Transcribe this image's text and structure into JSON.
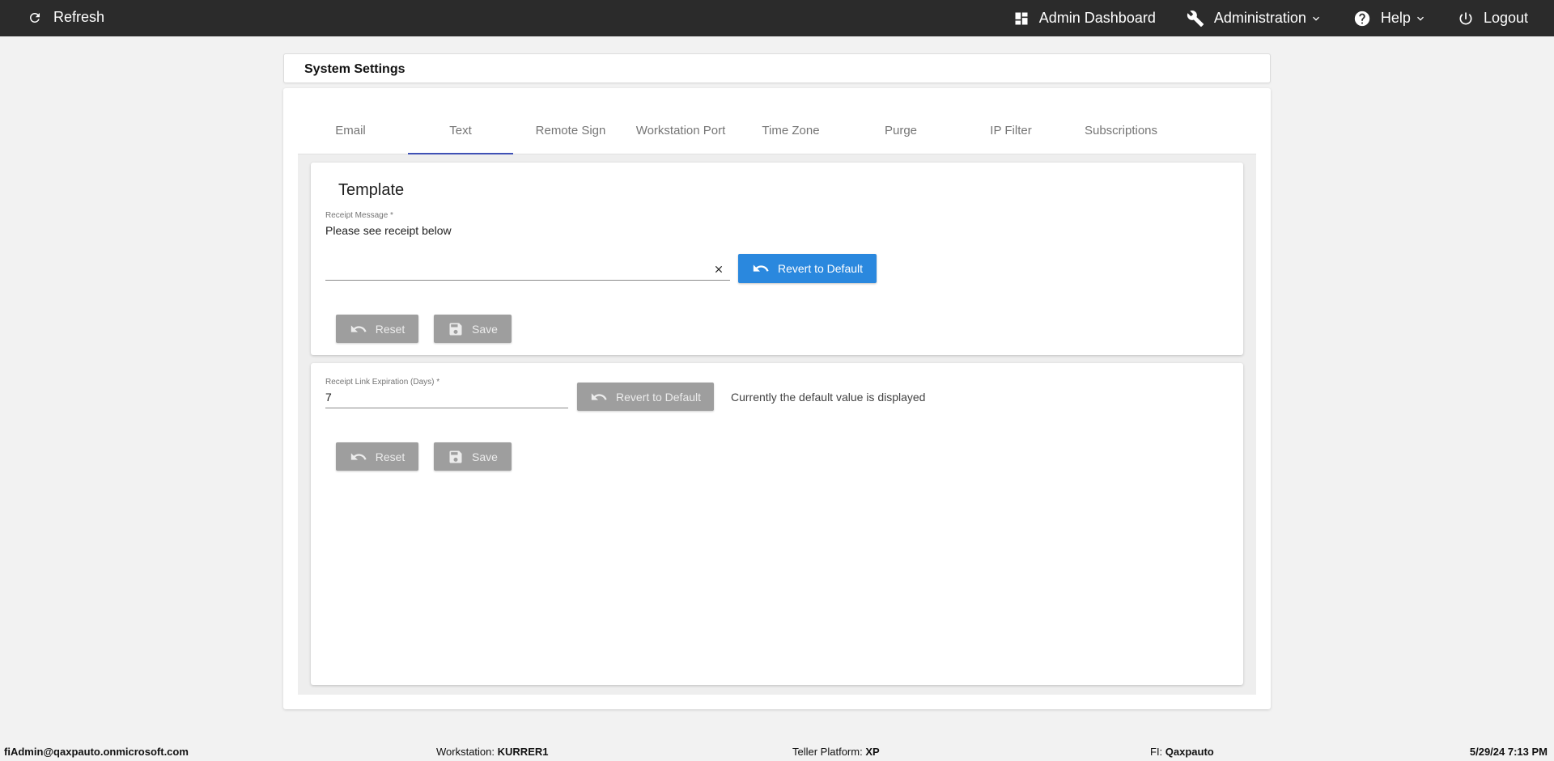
{
  "topbar": {
    "refresh_label": "Refresh",
    "admin_dashboard_label": "Admin Dashboard",
    "administration_label": "Administration",
    "help_label": "Help",
    "logout_label": "Logout"
  },
  "page": {
    "title": "System Settings"
  },
  "tabs": [
    {
      "label": "Email"
    },
    {
      "label": "Text"
    },
    {
      "label": "Remote Sign"
    },
    {
      "label": "Workstation Port"
    },
    {
      "label": "Time Zone"
    },
    {
      "label": "Purge"
    },
    {
      "label": "IP Filter"
    },
    {
      "label": "Subscriptions"
    }
  ],
  "active_tab": "Text",
  "template_card": {
    "title": "Template",
    "receipt_message_label": "Receipt Message *",
    "receipt_message_value": "Please see receipt below",
    "revert_label": "Revert to Default",
    "reset_label": "Reset",
    "save_label": "Save"
  },
  "expiration_card": {
    "field_label": "Receipt Link Expiration (Days) *",
    "field_value": "7",
    "revert_label": "Revert to Default",
    "note": "Currently the default value is displayed",
    "reset_label": "Reset",
    "save_label": "Save"
  },
  "footer": {
    "user": "fiAdmin@qaxpauto.onmicrosoft.com",
    "workstation_label": "Workstation:",
    "workstation_value": "KURRER1",
    "teller_label": "Teller Platform:",
    "teller_value": "XP",
    "fi_label": "FI:",
    "fi_value": "Qaxpauto",
    "datetime": "5/29/24 7:13 PM"
  },
  "colors": {
    "topbar_bg": "#2b2b2b",
    "primary_button": "#2a88de",
    "disabled_button": "#9e9e9e",
    "tab_indicator": "#3f51b5"
  },
  "icons": [
    "refresh-icon",
    "dashboard-icon",
    "wrench-icon",
    "help-circle-icon",
    "power-icon",
    "chevron-down-icon",
    "undo-icon",
    "save-icon",
    "close-icon"
  ]
}
